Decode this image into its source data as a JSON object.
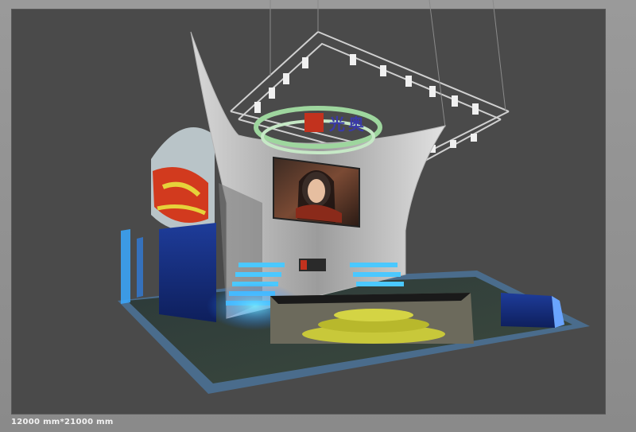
{
  "image": {
    "caption": "12000 mm*21000 mm",
    "description_hidden": ""
  },
  "colors": {
    "background": "#4a4a4a",
    "frame": "#8c8c8c",
    "accent_blue": "#2fa8ff",
    "accent_cyan": "#58e0ff",
    "accent_red": "#d23a1e",
    "accent_yellow": "#e6d23a"
  },
  "signage": {
    "logo_text": "光",
    "logo_text_right": "奥"
  }
}
